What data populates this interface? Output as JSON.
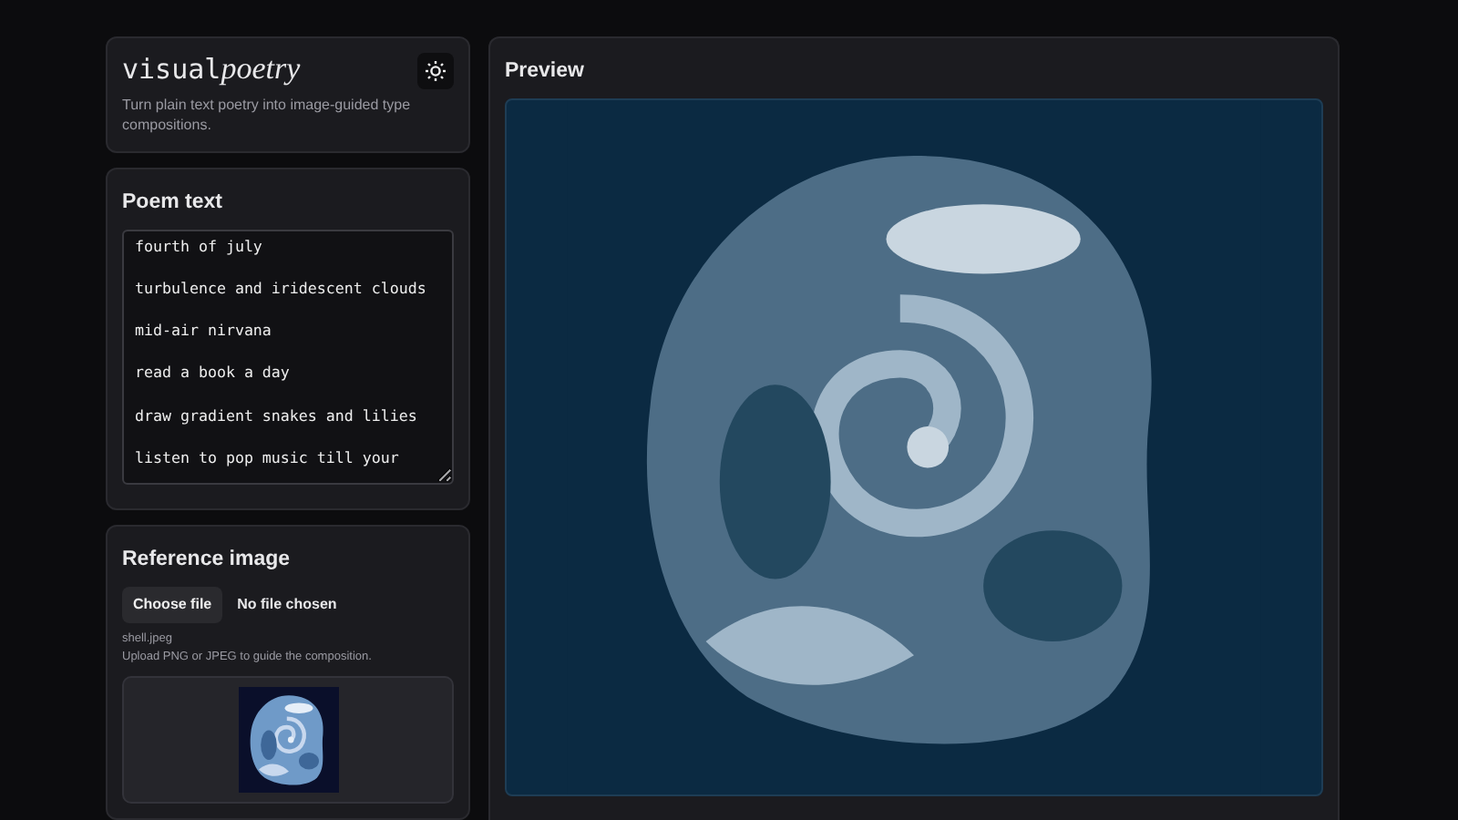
{
  "brand": {
    "title": "visual",
    "title_italic": "poetry",
    "tagline": "Turn plain text poetry into image-guided type compositions."
  },
  "poem": {
    "heading": "Poem text",
    "value": "fourth of july\n\nturbulence and iridescent clouds\n\nmid-air nirvana\n\nread a book a day\n\ndraw gradient snakes and lilies\n\nlisten to pop music till your"
  },
  "reference": {
    "heading": "Reference image",
    "button": "Choose file",
    "file_status": "No file chosen",
    "filename": "shell.jpeg",
    "hint": "Upload PNG or JPEG to guide the composition."
  },
  "preview": {
    "heading": "Preview"
  }
}
